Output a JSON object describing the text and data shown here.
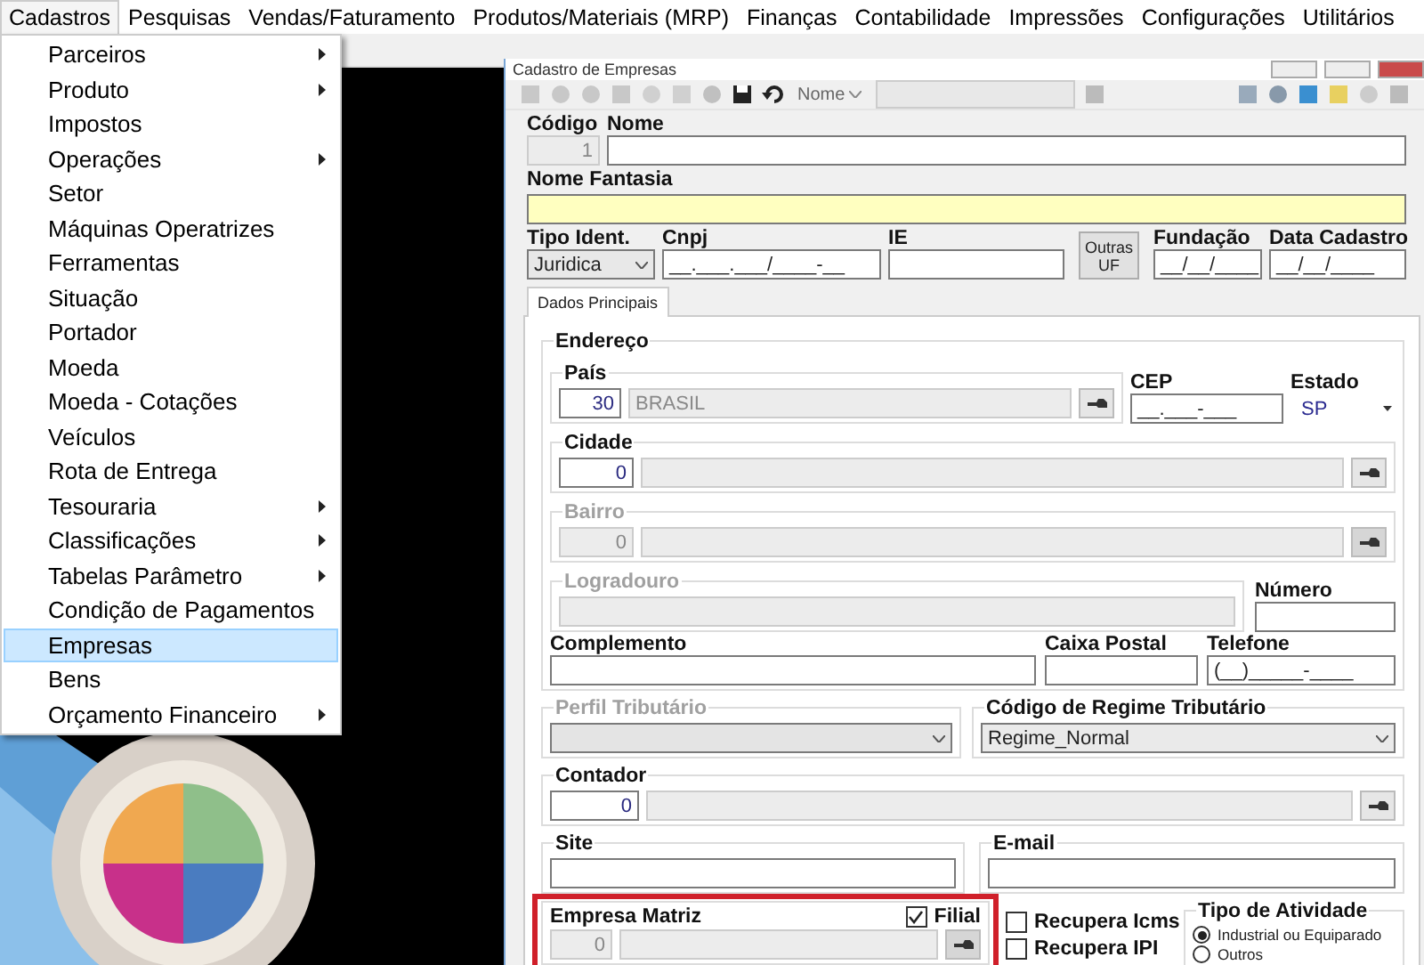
{
  "menu_bar": [
    {
      "label": "Cadastros",
      "selected": true
    },
    {
      "label": "Pesquisas",
      "selected": false
    },
    {
      "label": "Vendas/Faturamento",
      "selected": false
    },
    {
      "label": "Produtos/Materiais (MRP)",
      "selected": false
    },
    {
      "label": "Finanças",
      "selected": false
    },
    {
      "label": "Contabilidade",
      "selected": false
    },
    {
      "label": "Impressões",
      "selected": false
    },
    {
      "label": "Configurações",
      "selected": false
    },
    {
      "label": "Utilitários",
      "selected": false
    }
  ],
  "dropdown_menu": {
    "items": [
      {
        "label": "Parceiros",
        "has_submenu": true,
        "selected": false
      },
      {
        "label": "Produto",
        "has_submenu": true,
        "selected": false
      },
      {
        "label": "Impostos",
        "has_submenu": false,
        "selected": false
      },
      {
        "label": "Operações",
        "has_submenu": true,
        "selected": false
      },
      {
        "label": "Setor",
        "has_submenu": false,
        "selected": false
      },
      {
        "label": "Máquinas Operatrizes",
        "has_submenu": false,
        "selected": false
      },
      {
        "label": "Ferramentas",
        "has_submenu": false,
        "selected": false
      },
      {
        "label": "Situação",
        "has_submenu": false,
        "selected": false
      },
      {
        "label": "Portador",
        "has_submenu": false,
        "selected": false
      },
      {
        "label": "Moeda",
        "has_submenu": false,
        "selected": false
      },
      {
        "label": "Moeda - Cotações",
        "has_submenu": false,
        "selected": false
      },
      {
        "label": "Veículos",
        "has_submenu": false,
        "selected": false
      },
      {
        "label": "Rota de Entrega",
        "has_submenu": false,
        "selected": false
      },
      {
        "label": "Tesouraria",
        "has_submenu": true,
        "selected": false
      },
      {
        "label": "Classificações",
        "has_submenu": true,
        "selected": false
      },
      {
        "label": "Tabelas Parâmetro",
        "has_submenu": true,
        "selected": false
      },
      {
        "label": "Condição de Pagamentos",
        "has_submenu": false,
        "selected": false
      },
      {
        "label": "Empresas",
        "has_submenu": false,
        "selected": true
      },
      {
        "label": "Bens",
        "has_submenu": false,
        "selected": false
      },
      {
        "label": "Orçamento Financeiro",
        "has_submenu": true,
        "selected": false
      }
    ]
  },
  "window": {
    "title": "Cadastro de Empresas"
  },
  "toolbar": {
    "search_by": "Nome"
  },
  "form": {
    "codigo": {
      "label": "Código",
      "value": "1"
    },
    "nome": {
      "label": "Nome"
    },
    "nome_fantasia": {
      "label": "Nome Fantasia"
    },
    "tipo_ident": {
      "label": "Tipo Ident.",
      "value": "Juridica"
    },
    "cnpj": {
      "label": "Cnpj",
      "value": "__.___.___/____-__"
    },
    "ie": {
      "label": "IE"
    },
    "outras_uf_button": "Outras UF",
    "fundacao": {
      "label": "Fundação",
      "value": "__/__/____"
    },
    "data_cadastro": {
      "label": "Data Cadastro",
      "value": "__/__/____"
    }
  },
  "tabs": [
    {
      "label": "Dados Principais",
      "selected": true
    }
  ],
  "endereco": {
    "title": "Endereço",
    "pais": {
      "label": "País",
      "code": "30",
      "name": "BRASIL",
      "disabled": false
    },
    "cep": {
      "label": "CEP",
      "value": "__.___-___"
    },
    "estado": {
      "label": "Estado",
      "value": "SP"
    },
    "cidade": {
      "label": "Cidade",
      "code": "0",
      "disabled": false
    },
    "bairro": {
      "label": "Bairro",
      "code": "0",
      "disabled": true
    },
    "logradouro": {
      "label": "Logradouro",
      "disabled": true
    },
    "numero": {
      "label": "Número"
    },
    "complemento": {
      "label": "Complemento"
    },
    "caixa_postal": {
      "label": "Caixa Postal"
    },
    "telefone": {
      "label": "Telefone",
      "value": "(__)_____-____"
    }
  },
  "perfil_tributario": {
    "label": "Perfil Tributário",
    "disabled": true
  },
  "regime_tributario": {
    "label": "Código de Regime Tributário",
    "value": "Regime_Normal"
  },
  "contador": {
    "label": "Contador",
    "code": "0",
    "disabled": false
  },
  "site": {
    "label": "Site"
  },
  "email": {
    "label": "E-mail"
  },
  "empresa_matriz": {
    "label": "Empresa Matriz",
    "code": "0",
    "disabled": true,
    "highlighted": true
  },
  "filial": {
    "label": "Filial",
    "checked": true
  },
  "recupera": [
    {
      "label": "Recupera Icms",
      "checked": false
    },
    {
      "label": "Recupera IPI",
      "checked": false
    }
  ],
  "tipo_atividade": {
    "label": "Tipo de Atividade",
    "options": [
      {
        "label": "Industrial ou Equiparado",
        "selected": true
      },
      {
        "label": "Outros",
        "selected": false
      }
    ]
  }
}
